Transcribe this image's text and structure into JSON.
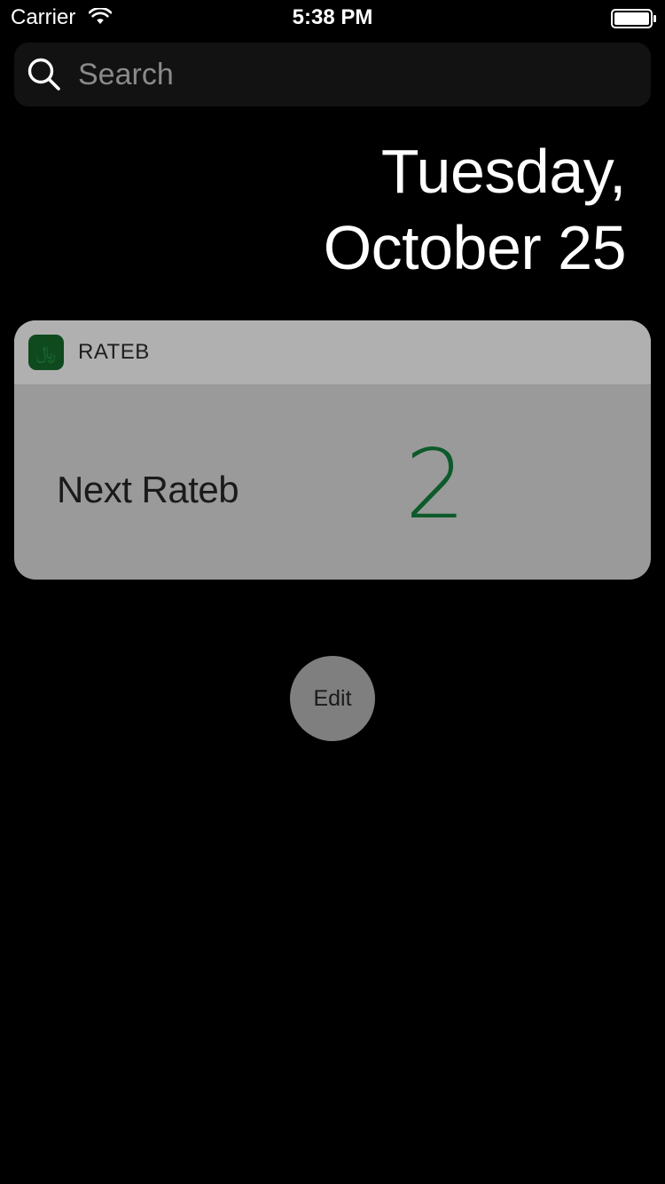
{
  "status_bar": {
    "carrier": "Carrier",
    "time": "5:38 PM",
    "wifi_icon": "wifi-icon",
    "battery_icon": "battery-icon"
  },
  "search": {
    "placeholder": "Search",
    "icon": "search-icon"
  },
  "date": {
    "line1": "Tuesday,",
    "line2": "October 25"
  },
  "widget": {
    "app_name": "RATEB",
    "app_icon": "rateb-app-icon",
    "label": "Next Rateb",
    "value": "2"
  },
  "edit_button": {
    "label": "Edit"
  },
  "colors": {
    "background": "#000000",
    "search_bar": "#121212",
    "widget_header": "#b0b0b0",
    "widget_body": "#9a9a9a",
    "app_icon": "#0f4a1f",
    "value_text": "#0d5a2a",
    "edit_button": "#7f7f7f"
  }
}
